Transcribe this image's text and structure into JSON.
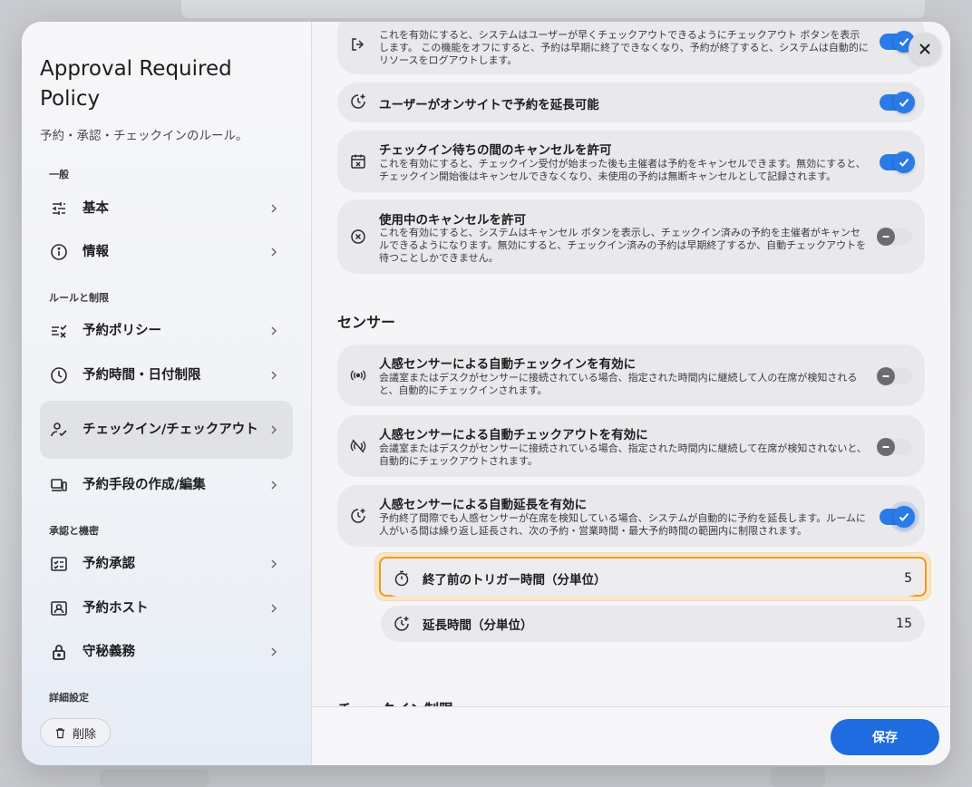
{
  "sidebar": {
    "title": "Approval Required Policy",
    "subtitle": "予約・承認・チェックインのルール。",
    "sections": {
      "general": "一般",
      "rules": "ルールと制限",
      "approval": "承認と機密",
      "advanced": "詳細設定"
    },
    "items": [
      {
        "label": "基本",
        "icon": "sliders-icon"
      },
      {
        "label": "情報",
        "icon": "info-icon"
      },
      {
        "label": "予約ポリシー",
        "icon": "list-check-icon"
      },
      {
        "label": "予約時間・日付制限",
        "icon": "clock-icon"
      },
      {
        "label": "チェックイン/チェックアウト",
        "icon": "person-check-icon",
        "active": true
      },
      {
        "label": "予約手段の作成/編集",
        "icon": "devices-icon"
      },
      {
        "label": "予約承認",
        "icon": "checklist-icon"
      },
      {
        "label": "予約ホスト",
        "icon": "host-card-icon"
      },
      {
        "label": "守秘義務",
        "icon": "lock-icon"
      }
    ],
    "delete_label": "削除"
  },
  "cards": [
    {
      "title": "",
      "desc": "これを有効にすると、システムはユーザーが早くチェックアウトできるようにチェックアウト ボタンを表示します。 この機能をオフにすると、予約は早期に終了できなくなり、予約が終了すると、システムは自動的にリソースをログアウトします。",
      "on": true,
      "icon": "logout-icon"
    },
    {
      "title": "ユーザーがオンサイトで予約を延長可能",
      "desc": "",
      "on": true,
      "icon": "clock-plus-icon"
    },
    {
      "title": "チェックイン待ちの間のキャンセルを許可",
      "desc": "これを有効にすると、チェックイン受付が始まった後も主催者は予約をキャンセルできます。無効にすると、チェックイン開始後はキャンセルできなくなり、未使用の予約は無断キャンセルとして記録されます。",
      "on": true,
      "icon": "calendar-x-icon"
    },
    {
      "title": "使用中のキャンセルを許可",
      "desc": "これを有効にすると、システムはキャンセル ボタンを表示し、チェックイン済みの予約を主催者がキャンセルできるようになります。無効にすると、チェックイン済みの予約は早期終了するか、自動チェックアウトを待つことしかできません。",
      "on": false,
      "icon": "circle-x-icon"
    }
  ],
  "sensor_section": "センサー",
  "sensor_cards": [
    {
      "title": "人感センサーによる自動チェックインを有効に",
      "desc": "会議室またはデスクがセンサーに接続されている場合、指定された時間内に継続して人の在席が検知されると、自動的にチェックインされます。",
      "on": false,
      "icon": "sensor-icon"
    },
    {
      "title": "人感センサーによる自動チェックアウトを有効に",
      "desc": "会議室またはデスクがセンサーに接続されている場合、指定された時間内に継続して在席が検知されないと、自動的にチェックアウトされます。",
      "on": false,
      "icon": "sensor-off-icon"
    },
    {
      "title": "人感センサーによる自動延長を有効に",
      "desc": "予約終了間際でも人感センサーが在席を検知している場合、システムが自動的に予約を延長します。ルームに人がいる間は繰り返し延長され、次の予約・営業時間・最大予約時間の範囲内に制限されます。",
      "on": true,
      "icon": "clock-plus-icon"
    }
  ],
  "sub_rows": [
    {
      "label": "終了前のトリガー時間（分単位）",
      "value": "5",
      "icon": "stopwatch-icon"
    },
    {
      "label": "延長時間（分単位）",
      "value": "15",
      "icon": "clock-plus-icon"
    }
  ],
  "next_section_partial": "チェックイン制限",
  "footer": {
    "save_label": "保存"
  },
  "colors": {
    "accent": "#1f6ce0",
    "toggle_on": "#2a7ae8",
    "focus": "#f09a1a"
  }
}
